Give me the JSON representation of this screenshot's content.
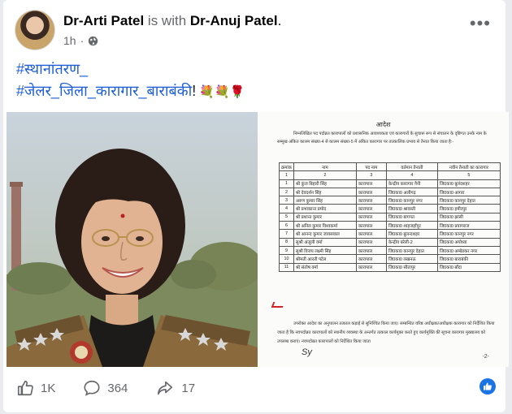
{
  "post": {
    "author": "Dr-Arti Patel",
    "with_text": "is with",
    "tagged": "Dr-Anuj Patel",
    "period": ".",
    "time": "1h",
    "caption_line1": "#स्थानांतरण_",
    "caption_line2": "#जेलर_जिला_कारागार_बाराबंकी",
    "caption_bang": "!",
    "flowers": "💐💐🌹"
  },
  "document": {
    "title": "आदेश",
    "intro": "निम्नलिखित पद पदोन्नत कारापालों को प्रशासनिक आवश्यकता एवं कारागारों के सुचारू रूप से संचालन के दृष्टिगत उनके नाम के सम्मुख अंकित कालम संख्या-4 से कालम संख्या-5 में अंकित कारागार पर तात्कालिक प्रभाव से तैनात किया जाता है:-",
    "headers": [
      "क्रमांक",
      "नाम",
      "पद नाम",
      "वर्तमान तैनाती",
      "नवीन तैनाती का कारागार"
    ],
    "subheaders": [
      "1",
      "2",
      "3",
      "4",
      "5"
    ],
    "rows": [
      [
        "1",
        "श्री कुंज बिहारी सिंह",
        "कारापाल",
        "केन्द्रीय कारागार नैनी",
        "जि0का0 बुलंदशहर"
      ],
      [
        "2",
        "श्री देवदर्शन सिंह",
        "कारापाल",
        "जि0का0 अलीगढ़",
        "जि0का0 आगरा"
      ],
      [
        "3",
        "अरुण कुमार सिंह",
        "कारापाल",
        "जि0का0 कानपुर नगर",
        "जि0का0 कानपुर देहात"
      ],
      [
        "4",
        "श्री प्रभाकान्त प्रमोद",
        "कारापाल",
        "जि0का0 श्रावस्ती",
        "जि0का0 हमीरपुर"
      ],
      [
        "5",
        "श्री प्रशान्त कुमार",
        "कारापाल",
        "जि0का0 बागपत",
        "जि0का0 झांसी"
      ],
      [
        "6",
        "श्री अनिल कुमार विश्वकर्मा",
        "कारापाल",
        "जि0का0 शाहजहाँपुर",
        "जि0का0 प्रयागराज"
      ],
      [
        "7",
        "श्री आनन्द कुमार जायसवाल",
        "कारापाल",
        "जि0का0 बुलन्दशहर",
        "जि0का0 कानपुर नगर"
      ],
      [
        "8",
        "सुश्री अंजुली वर्मा",
        "कारापाल",
        "केन्द्रीय बरेली-2",
        "जि0का0 अयोध्या"
      ],
      [
        "9",
        "सुश्री विजय लक्ष्मी सिंह",
        "कारापाल",
        "जि0का0 कानपुर देहात",
        "जि0का0 अम्बेडकर नगर"
      ],
      [
        "10",
        "श्रीमती आरती पटेल",
        "कारापाल",
        "जि0का0 लखनऊ",
        "जि0का0 बाराबंकी"
      ],
      [
        "11",
        "श्री संतोष वर्मा",
        "कारापाल",
        "जि0का0 सीतापुर",
        "जि0का0 बाँदा"
      ]
    ],
    "footer": "उपरोक्त आदेश का अनुपालन तत्काल कड़ाई से सुनिश्चित किया जाए। सम्बन्धित वरिष्ठ अधीक्षक/अधीक्षक कारागार को निर्देशित किया जाता है कि नवपदोन्नत कारापालों को स्थानीय व्यवस्था के अन्तर्गत तत्काल कार्यमुक्त करते हुए कार्यमुक्ति की सूचना कारागार मुख्यालय को उपलब्ध कराएं। नवपदोन्नत कारापालों को निर्देशित किया जाता",
    "page_no": "-2-"
  },
  "actions": {
    "likes": "1K",
    "comments": "364",
    "shares": "17"
  },
  "colors": {
    "hashtag": "#1f5fd6",
    "brand_blue": "#1b74e4"
  }
}
